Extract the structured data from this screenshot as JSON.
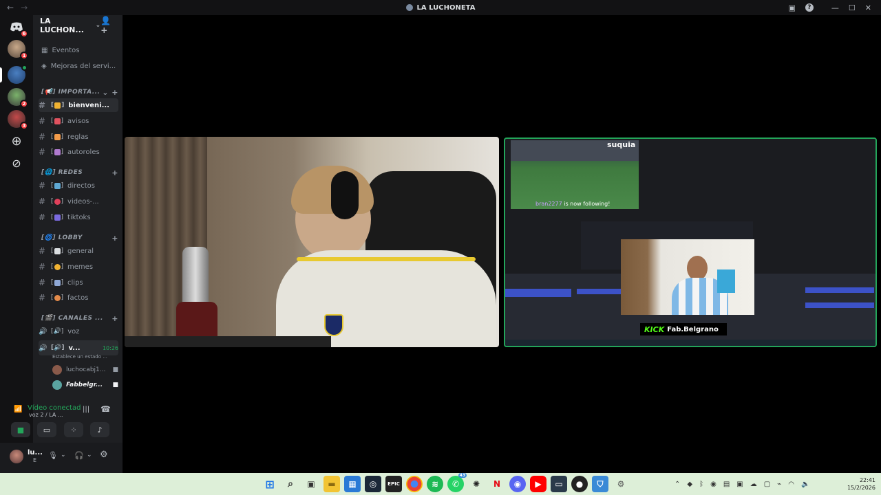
{
  "window": {
    "title": "LA LUCHONETA"
  },
  "server": {
    "name": "LA LUCHON..."
  },
  "rail": {
    "badges": [
      "6",
      "1",
      "2",
      "3"
    ]
  },
  "sidebar": {
    "events": "Eventos",
    "boosts": "Mejoras del servi...",
    "categories": {
      "importante": "[📢] IMPORTA...",
      "redes": "[🌐] REDES",
      "lobby": "[🌀] LOBBY",
      "canales": "[🎬] CANALES ..."
    },
    "channels": {
      "bienvenida": "bienveni...",
      "avisos": "avisos",
      "reglas": "reglas",
      "autoroles": "autoroles",
      "directos": "directos",
      "videos": "videos-...",
      "tiktoks": "tiktoks",
      "general": "general",
      "memes": "memes",
      "clips": "clips",
      "factos": "factos",
      "voz": "voz",
      "voz2": "v...",
      "voz2_time": "10:26",
      "voz2_status": "Establece un estado ..."
    },
    "voice_users": [
      "luchocabj1...",
      "Fabbelgr..."
    ]
  },
  "voice_panel": {
    "status": "Vídeo conectad",
    "sub": "voz 2 / LA ..."
  },
  "user": {
    "name": "lu...",
    "sub": "E"
  },
  "stream": {
    "suquia": "suquia",
    "follow_user": "bran2277",
    "follow_text": "is now following!",
    "kick_logo": "KICK",
    "kick_handle": "Fab.Belgrano"
  },
  "taskbar": {
    "time": "22:41",
    "date": "15/2/2026",
    "whatsapp_badge": "43"
  }
}
